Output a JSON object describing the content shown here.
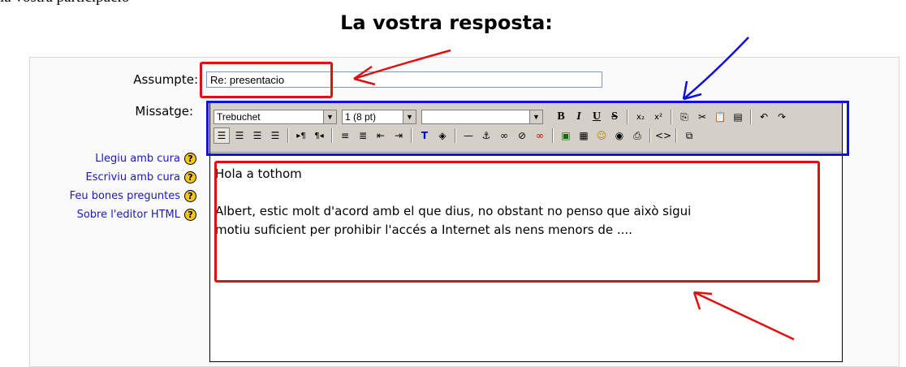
{
  "page": {
    "clipped_text": "la vostra participació",
    "heading": "La vostra resposta:"
  },
  "form": {
    "subject_label": "Assumpte:",
    "subject_value": "Re: presentacio",
    "message_label": "Missatge:"
  },
  "help_links": [
    {
      "label": "Llegiu amb cura",
      "icon": "help-icon"
    },
    {
      "label": "Escriviu amb cura",
      "icon": "help-icon"
    },
    {
      "label": "Feu bones preguntes",
      "icon": "help-icon"
    },
    {
      "label": "Sobre l'editor HTML",
      "icon": "help-icon"
    }
  ],
  "editor": {
    "font_select": "Trebuchet",
    "size_select": "1 (8 pt)",
    "style_select": "",
    "content_line1": "Hola a tothom",
    "content_line2": "Albert, estic molt d'acord amb el que dius, no obstant no penso que això sigui",
    "content_line3": "motiu suficient per prohibir l'accés a Internet als nens menors de ...."
  },
  "toolbar_buttons": {
    "bold": "B",
    "italic": "I",
    "underline": "U",
    "strike": "S",
    "subscript": "x₂",
    "superscript": "x²"
  },
  "annotation_colors": {
    "red": "#e01010",
    "blue": "#1010e0"
  }
}
